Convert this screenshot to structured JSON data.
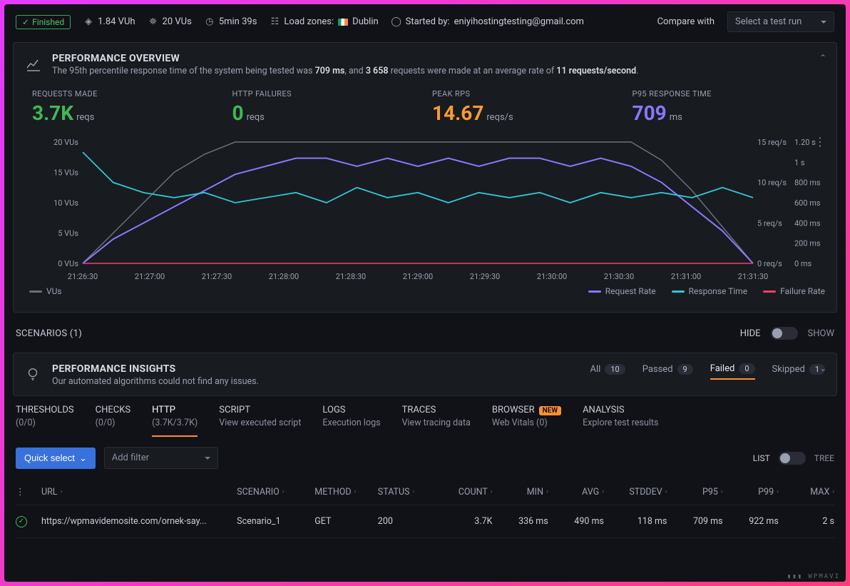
{
  "topbar": {
    "finished": "Finished",
    "vuh": "1.84 VUh",
    "vus": "20 VUs",
    "duration": "5min 39s",
    "load_zones_label": "Load zones:",
    "load_zone": "Dublin",
    "started_by_label": "Started by:",
    "started_by": "eniyihostingtesting@gmail.com",
    "compare_label": "Compare with",
    "select_placeholder": "Select a test run"
  },
  "overview": {
    "title": "PERFORMANCE OVERVIEW",
    "sub_prefix": "The 95th percentile response time of the system being tested was ",
    "sub_ms": "709 ms",
    "sub_mid": ", and ",
    "sub_reqs": "3 658",
    "sub_mid2": " requests were made at an average rate of ",
    "sub_rate": "11 requests/second",
    "sub_end": "."
  },
  "metrics": {
    "req_label": "REQUESTS MADE",
    "req_val": "3.7K",
    "req_unit": "reqs",
    "fail_label": "HTTP FAILURES",
    "fail_val": "0",
    "fail_unit": "reqs",
    "rps_label": "PEAK RPS",
    "rps_val": "14.67",
    "rps_unit": "reqs/s",
    "p95_label": "P95 RESPONSE TIME",
    "p95_val": "709",
    "p95_unit": "ms"
  },
  "chart_data": {
    "type": "line",
    "x_ticks": [
      "21:26:30",
      "21:27:00",
      "21:27:30",
      "21:28:00",
      "21:28:30",
      "21:29:00",
      "21:29:30",
      "21:30:00",
      "21:30:30",
      "21:31:00",
      "21:31:30"
    ],
    "left_axis": {
      "label": "VUs",
      "ticks": [
        "0 VUs",
        "5 VUs",
        "10 VUs",
        "15 VUs",
        "20 VUs"
      ],
      "range": [
        0,
        20
      ]
    },
    "right_axis_1": {
      "label": "req/s",
      "ticks": [
        "0 req/s",
        "5 req/s",
        "10 req/s",
        "15 req/s"
      ],
      "range": [
        0,
        15
      ]
    },
    "right_axis_2": {
      "label": "ms",
      "ticks": [
        "0 ms",
        "200 ms",
        "400 ms",
        "600 ms",
        "800 ms",
        "1 s",
        "1.20 s"
      ],
      "range": [
        0,
        1200
      ]
    },
    "series": [
      {
        "name": "VUs",
        "color": "#6b6f7b",
        "values": [
          0,
          5,
          10,
          15,
          18,
          20,
          20,
          20,
          20,
          20,
          20,
          20,
          20,
          20,
          20,
          20,
          20,
          20,
          20,
          17,
          12,
          6,
          0
        ]
      },
      {
        "name": "Request Rate",
        "color": "#8b77ff",
        "values": [
          0,
          3,
          5,
          7,
          9,
          11,
          12,
          13,
          13,
          12,
          13,
          12,
          13,
          12,
          13,
          13,
          12,
          13,
          12,
          10,
          7,
          4,
          0
        ]
      },
      {
        "name": "Response Time",
        "color": "#2fc6d6",
        "values": [
          1100,
          800,
          700,
          650,
          700,
          600,
          650,
          700,
          600,
          750,
          650,
          700,
          600,
          700,
          650,
          700,
          600,
          700,
          650,
          700,
          650,
          750,
          650
        ]
      },
      {
        "name": "Failure Rate",
        "color": "#ff3b6b",
        "values": [
          0,
          0,
          0,
          0,
          0,
          0,
          0,
          0,
          0,
          0,
          0,
          0,
          0,
          0,
          0,
          0,
          0,
          0,
          0,
          0,
          0,
          0,
          0
        ]
      }
    ],
    "legend": [
      "VUs",
      "Request Rate",
      "Response Time",
      "Failure Rate"
    ]
  },
  "scenarios": {
    "title": "SCENARIOS (1)",
    "hide": "HIDE",
    "show": "SHOW"
  },
  "insights": {
    "title": "PERFORMANCE INSIGHTS",
    "sub": "Our automated algorithms could not find any issues.",
    "tabs": {
      "all": "All",
      "all_c": "10",
      "passed": "Passed",
      "passed_c": "9",
      "failed": "Failed",
      "failed_c": "0",
      "skipped": "Skipped",
      "skipped_c": "1"
    }
  },
  "section_tabs": {
    "thresholds_t": "THRESHOLDS",
    "thresholds_s": "(0/0)",
    "checks_t": "CHECKS",
    "checks_s": "(0/0)",
    "http_t": "HTTP",
    "http_s": "(3.7K/3.7K)",
    "script_t": "SCRIPT",
    "script_s": "View executed script",
    "logs_t": "LOGS",
    "logs_s": "Execution logs",
    "traces_t": "TRACES",
    "traces_s": "View tracing data",
    "browser_t": "BROWSER",
    "browser_new": "NEW",
    "browser_s": "Web Vitals (0)",
    "analysis_t": "ANALYSIS",
    "analysis_s": "Explore test results"
  },
  "filters": {
    "quick": "Quick select",
    "add": "Add filter",
    "list": "LIST",
    "tree": "TREE"
  },
  "table": {
    "cols": {
      "url": "URL",
      "scenario": "SCENARIO",
      "method": "METHOD",
      "status": "STATUS",
      "count": "COUNT",
      "min": "MIN",
      "avg": "AVG",
      "stddev": "STDDEV",
      "p95": "P95",
      "p99": "P99",
      "max": "MAX"
    },
    "row": {
      "url": "https://wpmavidemosite.com/ornek-say...",
      "scenario": "Scenario_1",
      "method": "GET",
      "status": "200",
      "count": "3.7K",
      "min": "336 ms",
      "avg": "490 ms",
      "stddev": "118 ms",
      "p95": "709 ms",
      "p99": "922 ms",
      "max": "2 s"
    }
  },
  "watermark": "▮▮▮ WPMAVI"
}
